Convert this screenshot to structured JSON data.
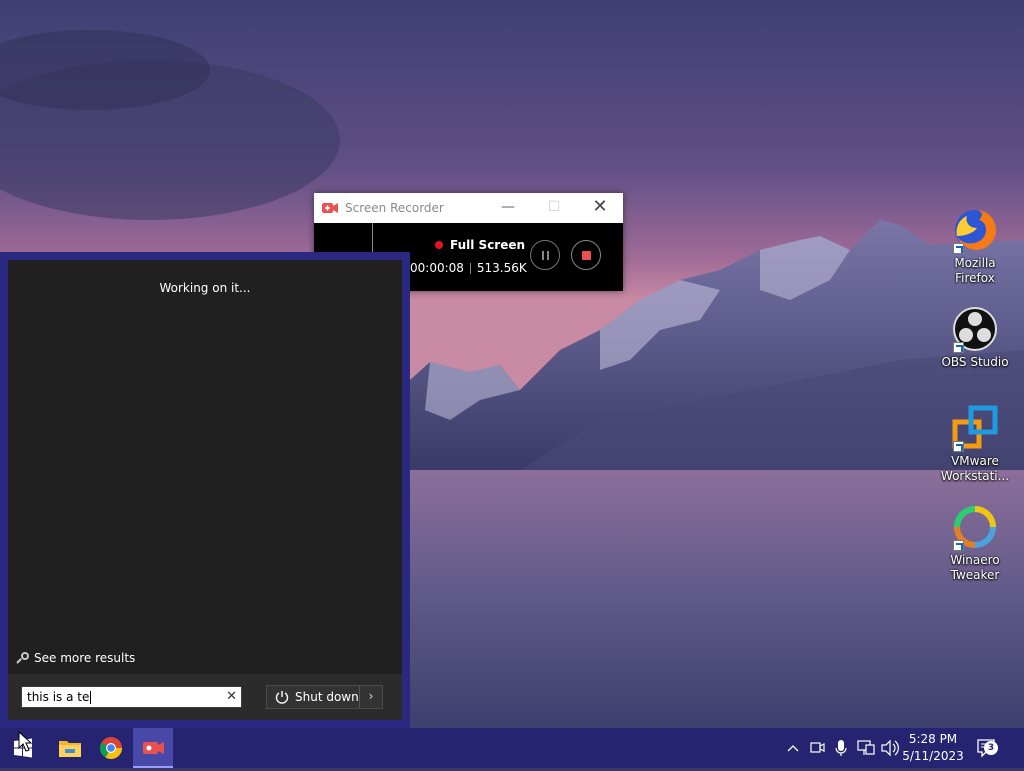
{
  "desktop": {
    "icons": [
      {
        "label": "Mozilla Firefox",
        "icon": "firefox-icon"
      },
      {
        "label": "OBS Studio",
        "icon": "obs-icon"
      },
      {
        "label": "VMware Workstati...",
        "icon": "vmware-icon"
      },
      {
        "label": "Winaero Tweaker",
        "icon": "winaero-icon"
      }
    ]
  },
  "recorder": {
    "title": "Screen Recorder",
    "mode": "Full Screen",
    "elapsed": "00:00:08",
    "size": "513.56K",
    "colors": {
      "record": "#e81123",
      "stop": "#e8514f"
    }
  },
  "start_menu": {
    "status": "Working on it...",
    "see_more": "See more results",
    "search_value": "this is a te",
    "shutdown_label": "Shut down"
  },
  "taskbar": {
    "apps": [
      "windows-start-icon",
      "file-explorer-icon",
      "chrome-icon",
      "screen-recorder-icon"
    ],
    "time": "5:28 PM",
    "date": "5/11/2023",
    "notification_count": "3",
    "accent": "#262470"
  }
}
